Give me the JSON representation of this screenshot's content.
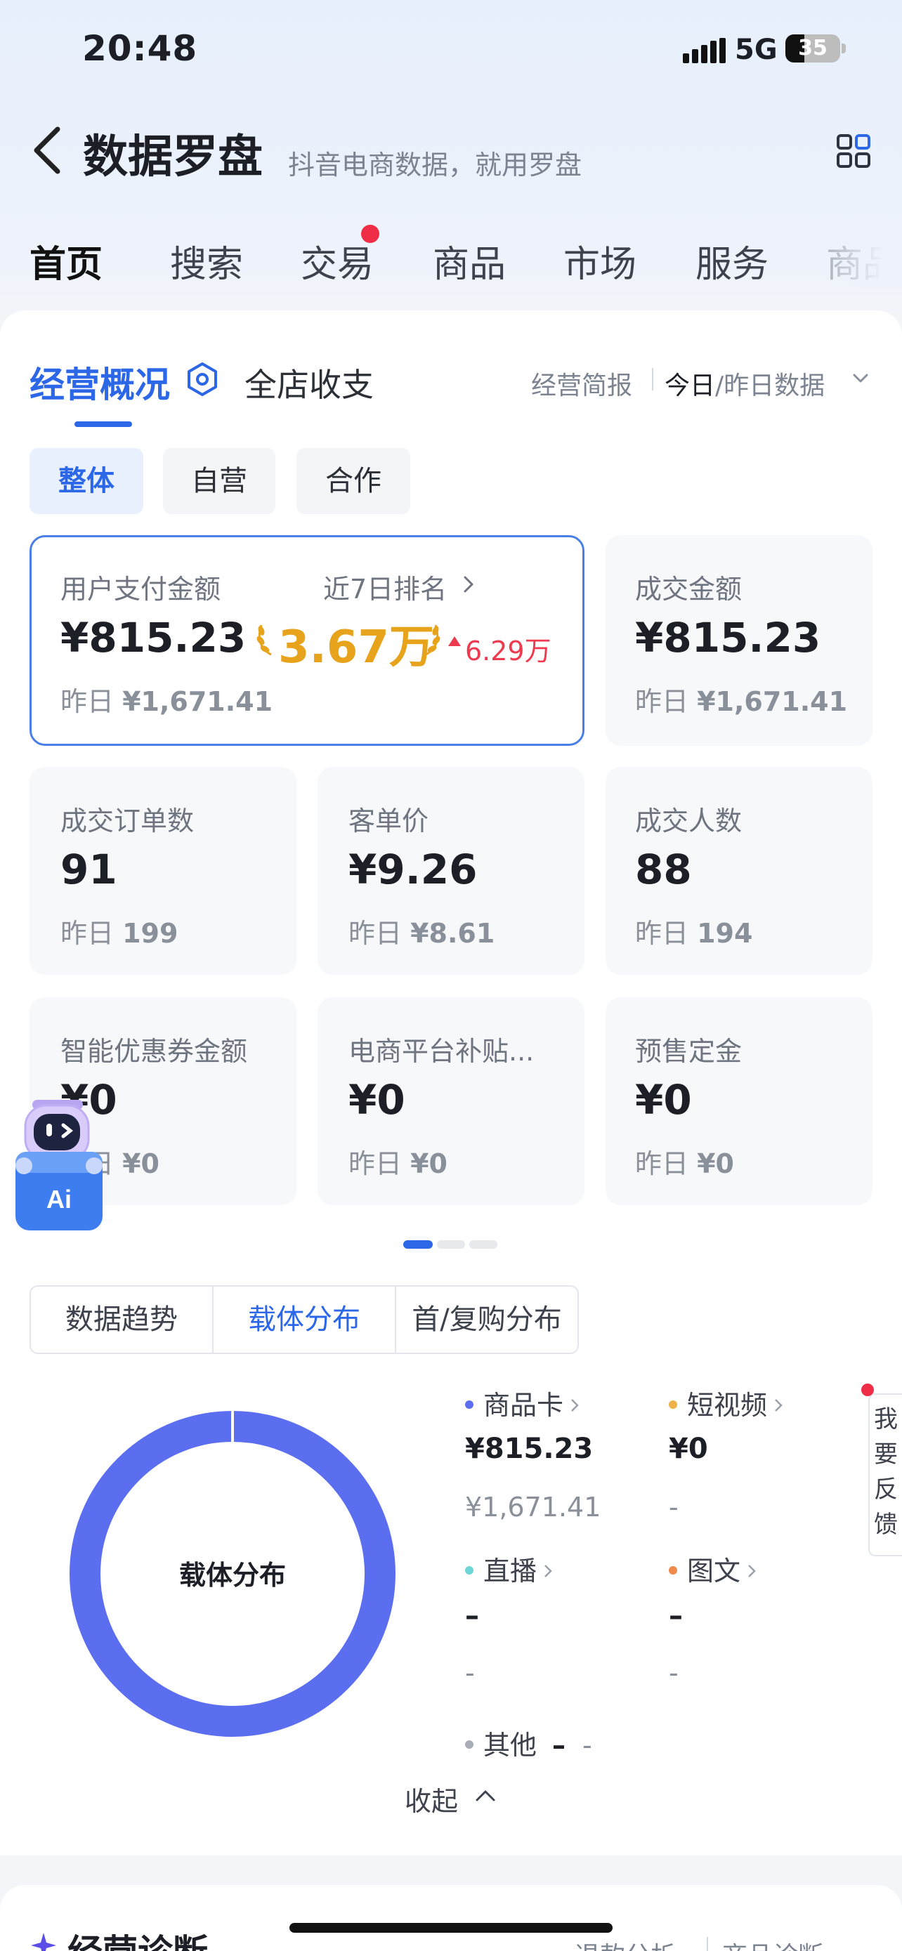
{
  "status": {
    "time": "20:48",
    "network": "5G",
    "battery_level": 35
  },
  "header": {
    "title": "数据罗盘",
    "subtitle": "抖音电商数据，就用罗盘"
  },
  "nav_tabs": [
    "首页",
    "搜索",
    "交易",
    "商品",
    "市场",
    "服务",
    "商品"
  ],
  "section": {
    "title": "经营概况",
    "tab2": "全店收支",
    "report_link": "经营简报",
    "date_on": "今日",
    "date_off": "/昨日数据"
  },
  "chips": [
    "整体",
    "自营",
    "合作"
  ],
  "metrics": {
    "pay_amount": {
      "label": "用户支付金额",
      "value": "¥815.23",
      "yday_prefix": "昨日",
      "yday": "¥1,671.41",
      "rank_label": "近7日排名",
      "rank_value": "3.67万",
      "rank_delta": "6.29万"
    },
    "deal_amount": {
      "label": "成交金额",
      "value": "¥815.23",
      "yday_prefix": "昨日",
      "yday": "¥1,671.41"
    },
    "orders": {
      "label": "成交订单数",
      "value": "91",
      "yday_prefix": "昨日",
      "yday": "199"
    },
    "avg_price": {
      "label": "客单价",
      "value": "¥9.26",
      "yday_prefix": "昨日",
      "yday": "¥8.61"
    },
    "buyers": {
      "label": "成交人数",
      "value": "88",
      "yday_prefix": "昨日",
      "yday": "194"
    },
    "coupon": {
      "label": "智能优惠券金额",
      "value": "¥0",
      "yday_prefix": "昨日",
      "yday": "¥0"
    },
    "subsidy": {
      "label": "电商平台补贴...",
      "value": "¥0",
      "yday_prefix": "昨日",
      "yday": "¥0"
    },
    "deposit": {
      "label": "预售定金",
      "value": "¥0",
      "yday_prefix": "昨日",
      "yday": "¥0"
    }
  },
  "dist_tabs": [
    "数据趋势",
    "载体分布",
    "首/复购分布"
  ],
  "donut": {
    "center_label": "载体分布",
    "color": "#5b6ef0",
    "share_product_card": 1.0
  },
  "legend": [
    {
      "name": "商品卡",
      "color": "#5b6ef0",
      "v1": "¥815.23",
      "v2": "¥1,671.41"
    },
    {
      "name": "短视频",
      "color": "#f0b14a",
      "v1": "¥0",
      "v2": "-"
    },
    {
      "name": "直播",
      "color": "#6fd6d6",
      "v1": "–",
      "v2": "-"
    },
    {
      "name": "图文",
      "color": "#f08a4a",
      "v1": "–",
      "v2": "-"
    }
  ],
  "legend_other": {
    "name": "其他",
    "v1": "–",
    "v2": "-"
  },
  "collapse_label": "收起",
  "feedback_chars": [
    "我",
    "要",
    "反",
    "馈"
  ],
  "diagnosis": {
    "title": "经营诊断",
    "link1": "退款分析",
    "link2": "商品诊断"
  },
  "colors": {
    "accent": "#2c67e8",
    "gold": "#e8a31c",
    "red": "#ee3a4f"
  }
}
